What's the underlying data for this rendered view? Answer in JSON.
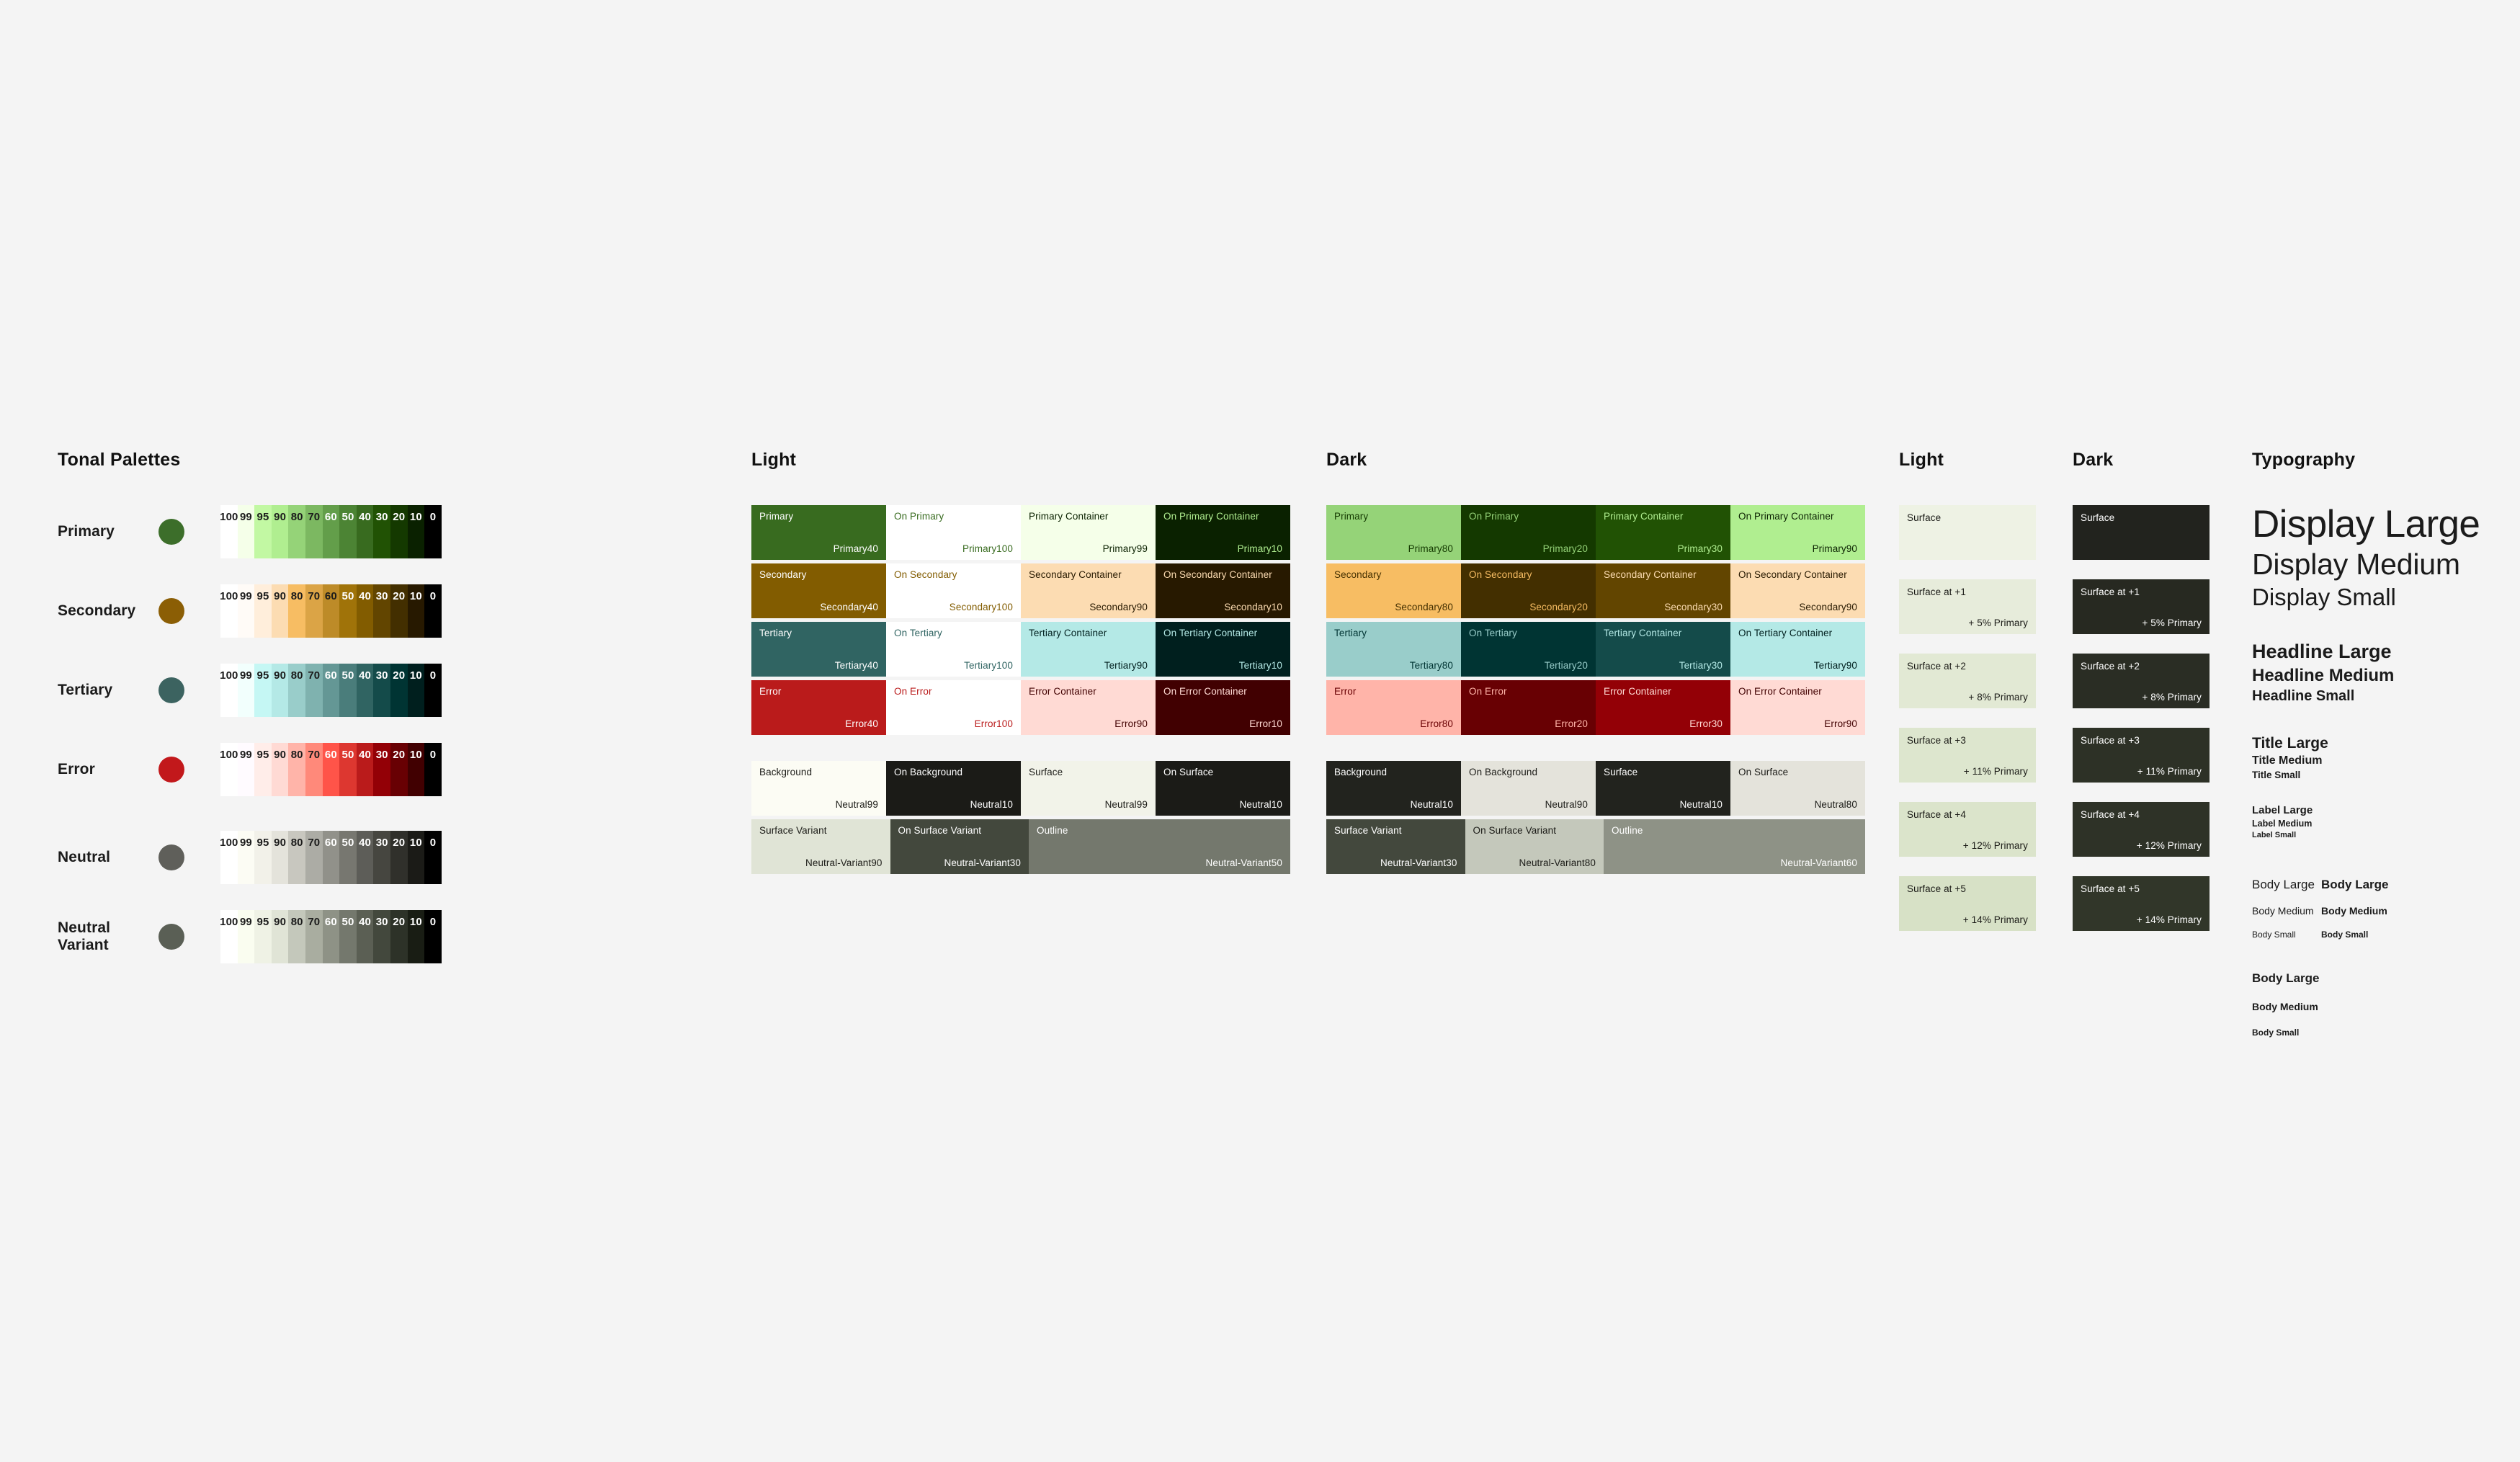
{
  "sections": {
    "tonal_palettes_title": "Tonal Palettes",
    "light_title": "Light",
    "dark_title": "Dark",
    "elev_light_title": "Light",
    "elev_dark_title": "Dark",
    "typography_title": "Typography"
  },
  "tonal_palettes": {
    "tones": [
      "100",
      "99",
      "95",
      "90",
      "80",
      "70",
      "60",
      "50",
      "40",
      "30",
      "20",
      "10",
      "0"
    ],
    "rows": [
      {
        "name": "Primary",
        "dot": "#3c6e2a",
        "swatches": [
          {
            "tone": "100",
            "hex": "#ffffff",
            "fg": "#1b1b1b"
          },
          {
            "tone": "99",
            "hex": "#f5ffe9",
            "fg": "#1b1b1b"
          },
          {
            "tone": "95",
            "hex": "#c2f8a3",
            "fg": "#1b1b1b"
          },
          {
            "tone": "90",
            "hex": "#b0ee90",
            "fg": "#1b1b1b"
          },
          {
            "tone": "80",
            "hex": "#95d378",
            "fg": "#1b1b1b"
          },
          {
            "tone": "70",
            "hex": "#7cb861",
            "fg": "#1b1b1b"
          },
          {
            "tone": "60",
            "hex": "#639e4a",
            "fg": "#ffffff"
          },
          {
            "tone": "50",
            "hex": "#4c8434",
            "fg": "#ffffff"
          },
          {
            "tone": "40",
            "hex": "#386b1f",
            "fg": "#ffffff"
          },
          {
            "tone": "30",
            "hex": "#215204",
            "fg": "#ffffff"
          },
          {
            "tone": "20",
            "hex": "#143900",
            "fg": "#ffffff"
          },
          {
            "tone": "10",
            "hex": "#0a2100",
            "fg": "#ffffff"
          },
          {
            "tone": "0",
            "hex": "#000000",
            "fg": "#ffffff"
          }
        ]
      },
      {
        "name": "Secondary",
        "dot": "#8b5e05",
        "swatches": [
          {
            "tone": "100",
            "hex": "#ffffff",
            "fg": "#1b1b1b"
          },
          {
            "tone": "99",
            "hex": "#fffbf7",
            "fg": "#1b1b1b"
          },
          {
            "tone": "95",
            "hex": "#ffeedb",
            "fg": "#1b1b1b"
          },
          {
            "tone": "90",
            "hex": "#fcdcb2",
            "fg": "#1b1b1b"
          },
          {
            "tone": "80",
            "hex": "#f7bd63",
            "fg": "#1b1b1b"
          },
          {
            "tone": "70",
            "hex": "#dba446",
            "fg": "#1b1b1b"
          },
          {
            "tone": "60",
            "hex": "#bd8b28",
            "fg": "#1b1b1b"
          },
          {
            "tone": "50",
            "hex": "#a07309",
            "fg": "#ffffff"
          },
          {
            "tone": "40",
            "hex": "#825c00",
            "fg": "#ffffff"
          },
          {
            "tone": "30",
            "hex": "#624500",
            "fg": "#ffffff"
          },
          {
            "tone": "20",
            "hex": "#432f00",
            "fg": "#ffffff"
          },
          {
            "tone": "10",
            "hex": "#271900",
            "fg": "#ffffff"
          },
          {
            "tone": "0",
            "hex": "#000000",
            "fg": "#ffffff"
          }
        ]
      },
      {
        "name": "Tertiary",
        "dot": "#3c6360",
        "swatches": [
          {
            "tone": "100",
            "hex": "#ffffff",
            "fg": "#1b1b1b"
          },
          {
            "tone": "99",
            "hex": "#f2fffd",
            "fg": "#1b1b1b"
          },
          {
            "tone": "95",
            "hex": "#c5f7f4",
            "fg": "#1b1b1b"
          },
          {
            "tone": "90",
            "hex": "#b4e9e6",
            "fg": "#1b1b1b"
          },
          {
            "tone": "80",
            "hex": "#99cdca",
            "fg": "#1b1b1b"
          },
          {
            "tone": "70",
            "hex": "#7fb2af",
            "fg": "#1b1b1b"
          },
          {
            "tone": "60",
            "hex": "#649795",
            "fg": "#ffffff"
          },
          {
            "tone": "50",
            "hex": "#4a7d7b",
            "fg": "#ffffff"
          },
          {
            "tone": "40",
            "hex": "#306462",
            "fg": "#ffffff"
          },
          {
            "tone": "30",
            "hex": "#144b4a",
            "fg": "#ffffff"
          },
          {
            "tone": "20",
            "hex": "#003433",
            "fg": "#ffffff"
          },
          {
            "tone": "10",
            "hex": "#001f1e",
            "fg": "#ffffff"
          },
          {
            "tone": "0",
            "hex": "#000000",
            "fg": "#ffffff"
          }
        ]
      },
      {
        "name": "Error",
        "dot": "#c2181b",
        "swatches": [
          {
            "tone": "100",
            "hex": "#ffffff",
            "fg": "#1b1b1b"
          },
          {
            "tone": "99",
            "hex": "#fffbff",
            "fg": "#1b1b1b"
          },
          {
            "tone": "95",
            "hex": "#ffede9",
            "fg": "#1b1b1b"
          },
          {
            "tone": "90",
            "hex": "#ffdad4",
            "fg": "#1b1b1b"
          },
          {
            "tone": "80",
            "hex": "#ffb4a9",
            "fg": "#1b1b1b"
          },
          {
            "tone": "70",
            "hex": "#ff897a",
            "fg": "#1b1b1b"
          },
          {
            "tone": "60",
            "hex": "#ff5449",
            "fg": "#ffffff"
          },
          {
            "tone": "50",
            "hex": "#dd3730",
            "fg": "#ffffff"
          },
          {
            "tone": "40",
            "hex": "#ba1b1b",
            "fg": "#ffffff"
          },
          {
            "tone": "30",
            "hex": "#930006",
            "fg": "#ffffff"
          },
          {
            "tone": "20",
            "hex": "#680003",
            "fg": "#ffffff"
          },
          {
            "tone": "10",
            "hex": "#410001",
            "fg": "#ffffff"
          },
          {
            "tone": "0",
            "hex": "#000000",
            "fg": "#ffffff"
          }
        ]
      },
      {
        "name": "Neutral",
        "dot": "#5f5f5a",
        "swatches": [
          {
            "tone": "100",
            "hex": "#ffffff",
            "fg": "#1b1b1b"
          },
          {
            "tone": "99",
            "hex": "#fcfcf4",
            "fg": "#1b1b1b"
          },
          {
            "tone": "95",
            "hex": "#f2f1e9",
            "fg": "#1b1b1b"
          },
          {
            "tone": "90",
            "hex": "#e4e3db",
            "fg": "#1b1b1b"
          },
          {
            "tone": "80",
            "hex": "#c8c7bf",
            "fg": "#1b1b1b"
          },
          {
            "tone": "70",
            "hex": "#acaca5",
            "fg": "#1b1b1b"
          },
          {
            "tone": "60",
            "hex": "#91918a",
            "fg": "#ffffff"
          },
          {
            "tone": "50",
            "hex": "#777770",
            "fg": "#ffffff"
          },
          {
            "tone": "40",
            "hex": "#5d5d58",
            "fg": "#ffffff"
          },
          {
            "tone": "30",
            "hex": "#464640",
            "fg": "#ffffff"
          },
          {
            "tone": "20",
            "hex": "#30302b",
            "fg": "#ffffff"
          },
          {
            "tone": "10",
            "hex": "#1b1b17",
            "fg": "#ffffff"
          },
          {
            "tone": "0",
            "hex": "#000000",
            "fg": "#ffffff"
          }
        ]
      },
      {
        "name": "Neutral Variant",
        "dot": "#5a5f55",
        "swatches": [
          {
            "tone": "100",
            "hex": "#ffffff",
            "fg": "#1b1b1b"
          },
          {
            "tone": "99",
            "hex": "#fafdf0",
            "fg": "#1b1b1b"
          },
          {
            "tone": "95",
            "hex": "#eff2e5",
            "fg": "#1b1b1b"
          },
          {
            "tone": "90",
            "hex": "#e0e4d6",
            "fg": "#1b1b1b"
          },
          {
            "tone": "80",
            "hex": "#c4c8bb",
            "fg": "#1b1b1b"
          },
          {
            "tone": "70",
            "hex": "#a9ada0",
            "fg": "#1b1b1b"
          },
          {
            "tone": "60",
            "hex": "#8e9286",
            "fg": "#ffffff"
          },
          {
            "tone": "50",
            "hex": "#74786d",
            "fg": "#ffffff"
          },
          {
            "tone": "40",
            "hex": "#5b5f54",
            "fg": "#ffffff"
          },
          {
            "tone": "30",
            "hex": "#43483d",
            "fg": "#ffffff"
          },
          {
            "tone": "20",
            "hex": "#2d3228",
            "fg": "#ffffff"
          },
          {
            "tone": "10",
            "hex": "#191d14",
            "fg": "#ffffff"
          },
          {
            "tone": "0",
            "hex": "#000000",
            "fg": "#ffffff"
          }
        ]
      }
    ]
  },
  "light_scheme": {
    "rows": [
      [
        {
          "label": "Primary",
          "token": "Primary40",
          "bg": "#386b1f",
          "fg": "#ffffff"
        },
        {
          "label": "On Primary",
          "token": "Primary100",
          "bg": "#ffffff",
          "fg": "#386b1f"
        },
        {
          "label": "Primary Container",
          "token": "Primary99",
          "bg": "#f5ffe9",
          "fg": "#0a2100"
        },
        {
          "label": "On Primary Container",
          "token": "Primary10",
          "bg": "#0a2100",
          "fg": "#b0ee90"
        }
      ],
      [
        {
          "label": "Secondary",
          "token": "Secondary40",
          "bg": "#825c00",
          "fg": "#ffffff"
        },
        {
          "label": "On Secondary",
          "token": "Secondary100",
          "bg": "#ffffff",
          "fg": "#825c00"
        },
        {
          "label": "Secondary Container",
          "token": "Secondary90",
          "bg": "#fcdcb2",
          "fg": "#271900"
        },
        {
          "label": "On Secondary Container",
          "token": "Secondary10",
          "bg": "#271900",
          "fg": "#fcdcb2"
        }
      ],
      [
        {
          "label": "Tertiary",
          "token": "Tertiary40",
          "bg": "#306462",
          "fg": "#ffffff"
        },
        {
          "label": "On Tertiary",
          "token": "Tertiary100",
          "bg": "#ffffff",
          "fg": "#306462"
        },
        {
          "label": "Tertiary Container",
          "token": "Tertiary90",
          "bg": "#b4e9e6",
          "fg": "#001f1e"
        },
        {
          "label": "On Tertiary Container",
          "token": "Tertiary10",
          "bg": "#001f1e",
          "fg": "#b4e9e6"
        }
      ],
      [
        {
          "label": "Error",
          "token": "Error40",
          "bg": "#ba1b1b",
          "fg": "#ffffff"
        },
        {
          "label": "On Error",
          "token": "Error100",
          "bg": "#ffffff",
          "fg": "#ba1b1b"
        },
        {
          "label": "Error Container",
          "token": "Error90",
          "bg": "#ffdad4",
          "fg": "#410001"
        },
        {
          "label": "On Error Container",
          "token": "Error10",
          "bg": "#410001",
          "fg": "#ffdad4"
        }
      ]
    ],
    "surface_rows": [
      [
        {
          "label": "Background",
          "token": "Neutral99",
          "bg": "#fcfcf4",
          "fg": "#1b1b17"
        },
        {
          "label": "On Background",
          "token": "Neutral10",
          "bg": "#1b1b17",
          "fg": "#ffffff"
        },
        {
          "label": "Surface",
          "token": "Neutral99",
          "bg": "#f2f3e9",
          "fg": "#1b1b17"
        },
        {
          "label": "On Surface",
          "token": "Neutral10",
          "bg": "#1b1b17",
          "fg": "#ffffff"
        }
      ],
      [
        {
          "label": "Surface Variant",
          "token": "Neutral-Variant90",
          "bg": "#e0e4d6",
          "fg": "#1b1b17",
          "span": 1
        },
        {
          "label": "On Surface Variant",
          "token": "Neutral-Variant30",
          "bg": "#43483d",
          "fg": "#ffffff",
          "span": 1
        },
        {
          "label": "Outline",
          "token": "Neutral-Variant50",
          "bg": "#74786d",
          "fg": "#ffffff",
          "span": 2
        }
      ]
    ]
  },
  "dark_scheme": {
    "rows": [
      [
        {
          "label": "Primary",
          "token": "Primary80",
          "bg": "#95d378",
          "fg": "#143900"
        },
        {
          "label": "On Primary",
          "token": "Primary20",
          "bg": "#143900",
          "fg": "#95d378"
        },
        {
          "label": "Primary Container",
          "token": "Primary30",
          "bg": "#215204",
          "fg": "#b0ee90"
        },
        {
          "label": "On Primary Container",
          "token": "Primary90",
          "bg": "#b0ee90",
          "fg": "#0a2100"
        }
      ],
      [
        {
          "label": "Secondary",
          "token": "Secondary80",
          "bg": "#f7bd63",
          "fg": "#432f00"
        },
        {
          "label": "On Secondary",
          "token": "Secondary20",
          "bg": "#432f00",
          "fg": "#f7bd63"
        },
        {
          "label": "Secondary Container",
          "token": "Secondary30",
          "bg": "#624500",
          "fg": "#fcdcb2"
        },
        {
          "label": "On Secondary Container",
          "token": "Secondary90",
          "bg": "#fcdcb2",
          "fg": "#271900"
        }
      ],
      [
        {
          "label": "Tertiary",
          "token": "Tertiary80",
          "bg": "#99cdca",
          "fg": "#003433"
        },
        {
          "label": "On Tertiary",
          "token": "Tertiary20",
          "bg": "#003433",
          "fg": "#99cdca"
        },
        {
          "label": "Tertiary Container",
          "token": "Tertiary30",
          "bg": "#144b4a",
          "fg": "#b4e9e6"
        },
        {
          "label": "On Tertiary Container",
          "token": "Tertiary90",
          "bg": "#b4e9e6",
          "fg": "#001f1e"
        }
      ],
      [
        {
          "label": "Error",
          "token": "Error80",
          "bg": "#ffb4a9",
          "fg": "#680003"
        },
        {
          "label": "On Error",
          "token": "Error20",
          "bg": "#680003",
          "fg": "#ffb4a9"
        },
        {
          "label": "Error Container",
          "token": "Error30",
          "bg": "#930006",
          "fg": "#ffdad4"
        },
        {
          "label": "On Error Container",
          "token": "Error90",
          "bg": "#ffdad4",
          "fg": "#410001"
        }
      ]
    ],
    "surface_rows": [
      [
        {
          "label": "Background",
          "token": "Neutral10",
          "bg": "#22231e",
          "fg": "#ffffff"
        },
        {
          "label": "On Background",
          "token": "Neutral90",
          "bg": "#e4e3db",
          "fg": "#1b1b17"
        },
        {
          "label": "Surface",
          "token": "Neutral10",
          "bg": "#22231e",
          "fg": "#ffffff"
        },
        {
          "label": "On Surface",
          "token": "Neutral80",
          "bg": "#e4e3db",
          "fg": "#1b1b17"
        }
      ],
      [
        {
          "label": "Surface Variant",
          "token": "Neutral-Variant30",
          "bg": "#43483d",
          "fg": "#ffffff",
          "span": 1
        },
        {
          "label": "On Surface Variant",
          "token": "Neutral-Variant80",
          "bg": "#c4c8bb",
          "fg": "#1b1b17",
          "span": 1
        },
        {
          "label": "Outline",
          "token": "Neutral-Variant60",
          "bg": "#8e9286",
          "fg": "#ffffff",
          "span": 2
        }
      ]
    ]
  },
  "elevation_light": {
    "cards": [
      {
        "label": "Surface",
        "mix": "",
        "bg": "#eef2e4",
        "fg": "#1b1b17"
      },
      {
        "label": "Surface at +1",
        "mix": "+ 5% Primary",
        "bg": "#e7ecdb",
        "fg": "#1b1b17"
      },
      {
        "label": "Surface at +2",
        "mix": "+ 8% Primary",
        "bg": "#e2e9d4",
        "fg": "#1b1b17"
      },
      {
        "label": "Surface at +3",
        "mix": "+ 11% Primary",
        "bg": "#dde6ce",
        "fg": "#1b1b17"
      },
      {
        "label": "Surface at +4",
        "mix": "+ 12% Primary",
        "bg": "#dbe4cb",
        "fg": "#1b1b17"
      },
      {
        "label": "Surface at +5",
        "mix": "+ 14% Primary",
        "bg": "#d7e1c6",
        "fg": "#1b1b17"
      }
    ]
  },
  "elevation_dark": {
    "cards": [
      {
        "label": "Surface",
        "mix": "",
        "bg": "#22231e",
        "fg": "#ffffff"
      },
      {
        "label": "Surface at +1",
        "mix": "+ 5% Primary",
        "bg": "#272921",
        "fg": "#ffffff"
      },
      {
        "label": "Surface at +2",
        "mix": "+ 8% Primary",
        "bg": "#2a2d24",
        "fg": "#ffffff"
      },
      {
        "label": "Surface at +3",
        "mix": "+ 11% Primary",
        "bg": "#2d3126",
        "fg": "#ffffff"
      },
      {
        "label": "Surface at +4",
        "mix": "+ 12% Primary",
        "bg": "#2e3227",
        "fg": "#ffffff"
      },
      {
        "label": "Surface at +5",
        "mix": "+ 14% Primary",
        "bg": "#313629",
        "fg": "#ffffff"
      }
    ]
  },
  "typography": {
    "display_large": "Display Large",
    "display_medium": "Display Medium",
    "display_small": "Display Small",
    "headline_large": "Headline Large",
    "headline_medium": "Headline Medium",
    "headline_small": "Headline Small",
    "title_large": "Title Large",
    "title_medium": "Title Medium",
    "title_small": "Title Small",
    "label_large": "Label Large",
    "label_medium": "Label Medium",
    "label_small": "Label Small",
    "body_large_a": "Body Large",
    "body_medium_a": "Body Medium",
    "body_small_a": "Body Small",
    "body_large_b": "Body Large",
    "body_medium_b": "Body Medium",
    "body_small_b": "Body Small",
    "body_large_c": "Body Large",
    "body_medium_c": "Body Medium",
    "body_small_c": "Body Small"
  }
}
